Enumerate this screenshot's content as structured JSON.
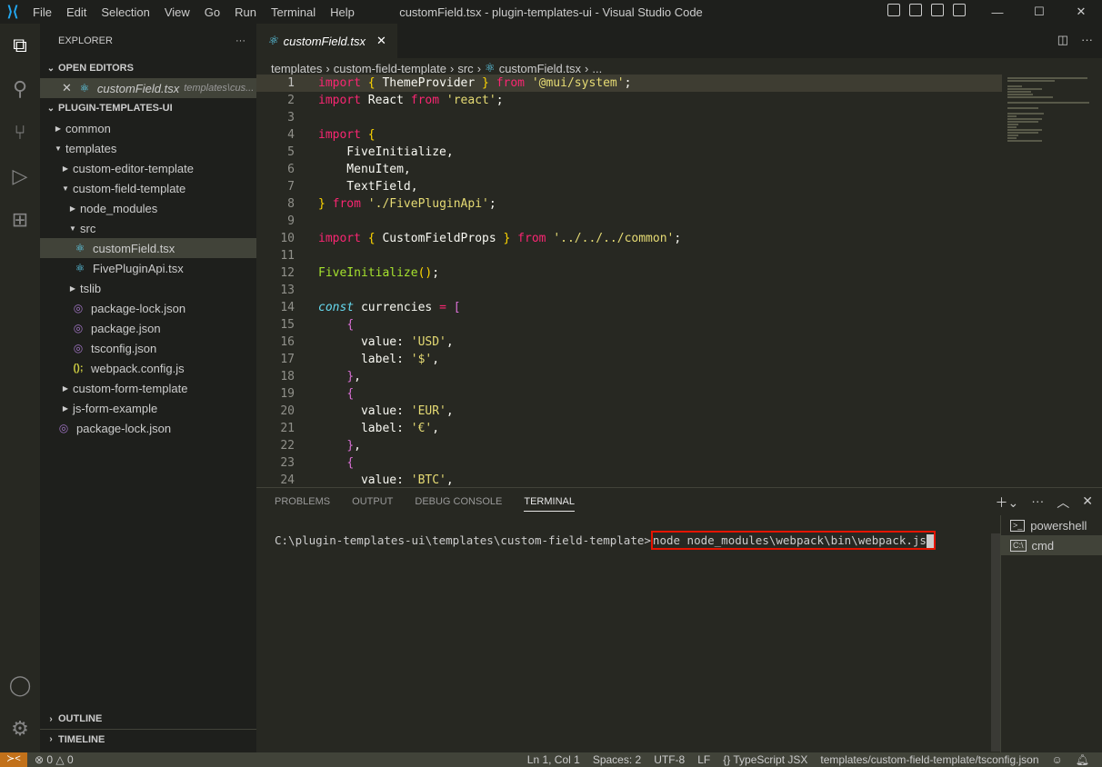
{
  "titlebar": {
    "menu": [
      "File",
      "Edit",
      "Selection",
      "View",
      "Go",
      "Run",
      "Terminal",
      "Help"
    ],
    "title": "customField.tsx - plugin-templates-ui - Visual Studio Code"
  },
  "sidebar": {
    "header": "EXPLORER",
    "more": "···",
    "open_editors": "OPEN EDITORS",
    "open_editor": {
      "name": "customField.tsx",
      "path": "templates\\cus..."
    },
    "project": "PLUGIN-TEMPLATES-UI",
    "tree": [
      {
        "label": "common",
        "depth": 0,
        "kind": "folder",
        "open": false
      },
      {
        "label": "templates",
        "depth": 0,
        "kind": "folder",
        "open": true
      },
      {
        "label": "custom-editor-template",
        "depth": 1,
        "kind": "folder",
        "open": false
      },
      {
        "label": "custom-field-template",
        "depth": 1,
        "kind": "folder",
        "open": true
      },
      {
        "label": "node_modules",
        "depth": 2,
        "kind": "folder",
        "open": false
      },
      {
        "label": "src",
        "depth": 2,
        "kind": "folder",
        "open": true
      },
      {
        "label": "customField.tsx",
        "depth": 3,
        "kind": "react",
        "selected": true
      },
      {
        "label": "FivePluginApi.tsx",
        "depth": 3,
        "kind": "react"
      },
      {
        "label": "tslib",
        "depth": 2,
        "kind": "folder",
        "open": false
      },
      {
        "label": "package-lock.json",
        "depth": 2,
        "kind": "json"
      },
      {
        "label": "package.json",
        "depth": 2,
        "kind": "json"
      },
      {
        "label": "tsconfig.json",
        "depth": 2,
        "kind": "json"
      },
      {
        "label": "webpack.config.js",
        "depth": 2,
        "kind": "js"
      },
      {
        "label": "custom-form-template",
        "depth": 1,
        "kind": "folder",
        "open": false
      },
      {
        "label": "js-form-example",
        "depth": 1,
        "kind": "folder",
        "open": false
      },
      {
        "label": "package-lock.json",
        "depth": 0,
        "kind": "json"
      }
    ],
    "outline": "OUTLINE",
    "timeline": "TIMELINE"
  },
  "editor": {
    "tab": "customField.tsx",
    "breadcrumb": [
      "templates",
      "custom-field-template",
      "src",
      "customField.tsx",
      "..."
    ],
    "lines": [
      [
        [
          "k",
          "import"
        ],
        [
          "p",
          " "
        ],
        [
          "b1",
          "{"
        ],
        [
          "p",
          " ThemeProvider "
        ],
        [
          "b1",
          "}"
        ],
        [
          "p",
          " "
        ],
        [
          "k",
          "from"
        ],
        [
          "p",
          " "
        ],
        [
          "s",
          "'@mui/system'"
        ],
        [
          "p",
          ";"
        ]
      ],
      [
        [
          "k",
          "import"
        ],
        [
          "p",
          " React "
        ],
        [
          "k",
          "from"
        ],
        [
          "p",
          " "
        ],
        [
          "s",
          "'react'"
        ],
        [
          "p",
          ";"
        ]
      ],
      [],
      [
        [
          "k",
          "import"
        ],
        [
          "p",
          " "
        ],
        [
          "b1",
          "{"
        ]
      ],
      [
        [
          "p",
          "    FiveInitialize,"
        ]
      ],
      [
        [
          "p",
          "    MenuItem,"
        ]
      ],
      [
        [
          "p",
          "    TextField,"
        ]
      ],
      [
        [
          "b1",
          "}"
        ],
        [
          "p",
          " "
        ],
        [
          "k",
          "from"
        ],
        [
          "p",
          " "
        ],
        [
          "s",
          "'./FivePluginApi'"
        ],
        [
          "p",
          ";"
        ]
      ],
      [],
      [
        [
          "k",
          "import"
        ],
        [
          "p",
          " "
        ],
        [
          "b1",
          "{"
        ],
        [
          "p",
          " CustomFieldProps "
        ],
        [
          "b1",
          "}"
        ],
        [
          "p",
          " "
        ],
        [
          "k",
          "from"
        ],
        [
          "p",
          " "
        ],
        [
          "s",
          "'../../../common'"
        ],
        [
          "p",
          ";"
        ]
      ],
      [],
      [
        [
          "f",
          "FiveInitialize"
        ],
        [
          "b1",
          "()"
        ],
        [
          "p",
          ";"
        ]
      ],
      [],
      [
        [
          "c",
          "const"
        ],
        [
          "p",
          " currencies "
        ],
        [
          "k",
          "="
        ],
        [
          "p",
          " "
        ],
        [
          "b2",
          "["
        ]
      ],
      [
        [
          "p",
          "    "
        ],
        [
          "b2",
          "{"
        ]
      ],
      [
        [
          "p",
          "      value: "
        ],
        [
          "s",
          "'USD'"
        ],
        [
          "p",
          ","
        ]
      ],
      [
        [
          "p",
          "      label: "
        ],
        [
          "s",
          "'$'"
        ],
        [
          "p",
          ","
        ]
      ],
      [
        [
          "p",
          "    "
        ],
        [
          "b2",
          "}"
        ],
        [
          "p",
          ","
        ]
      ],
      [
        [
          "p",
          "    "
        ],
        [
          "b2",
          "{"
        ]
      ],
      [
        [
          "p",
          "      value: "
        ],
        [
          "s",
          "'EUR'"
        ],
        [
          "p",
          ","
        ]
      ],
      [
        [
          "p",
          "      label: "
        ],
        [
          "s",
          "'€'"
        ],
        [
          "p",
          ","
        ]
      ],
      [
        [
          "p",
          "    "
        ],
        [
          "b2",
          "}"
        ],
        [
          "p",
          ","
        ]
      ],
      [
        [
          "p",
          "    "
        ],
        [
          "b2",
          "{"
        ]
      ],
      [
        [
          "p",
          "      value: "
        ],
        [
          "s",
          "'BTC'"
        ],
        [
          "p",
          ","
        ]
      ]
    ]
  },
  "panel": {
    "tabs": [
      "PROBLEMS",
      "OUTPUT",
      "DEBUG CONSOLE",
      "TERMINAL"
    ],
    "active": "TERMINAL",
    "prompt": "C:\\plugin-templates-ui\\templates\\custom-field-template>",
    "command": "node node_modules\\webpack\\bin\\webpack.js",
    "terminals": [
      "powershell",
      "cmd"
    ]
  },
  "status": {
    "errors": "0",
    "warnings": "0",
    "position": "Ln 1, Col 1",
    "spaces": "Spaces: 2",
    "encoding": "UTF-8",
    "eol": "LF",
    "language": "TypeScript JSX",
    "config": "templates/custom-field-template/tsconfig.json"
  },
  "colors": {
    "accent_remote": "#c2711a",
    "highlight_box": "#e51400"
  }
}
